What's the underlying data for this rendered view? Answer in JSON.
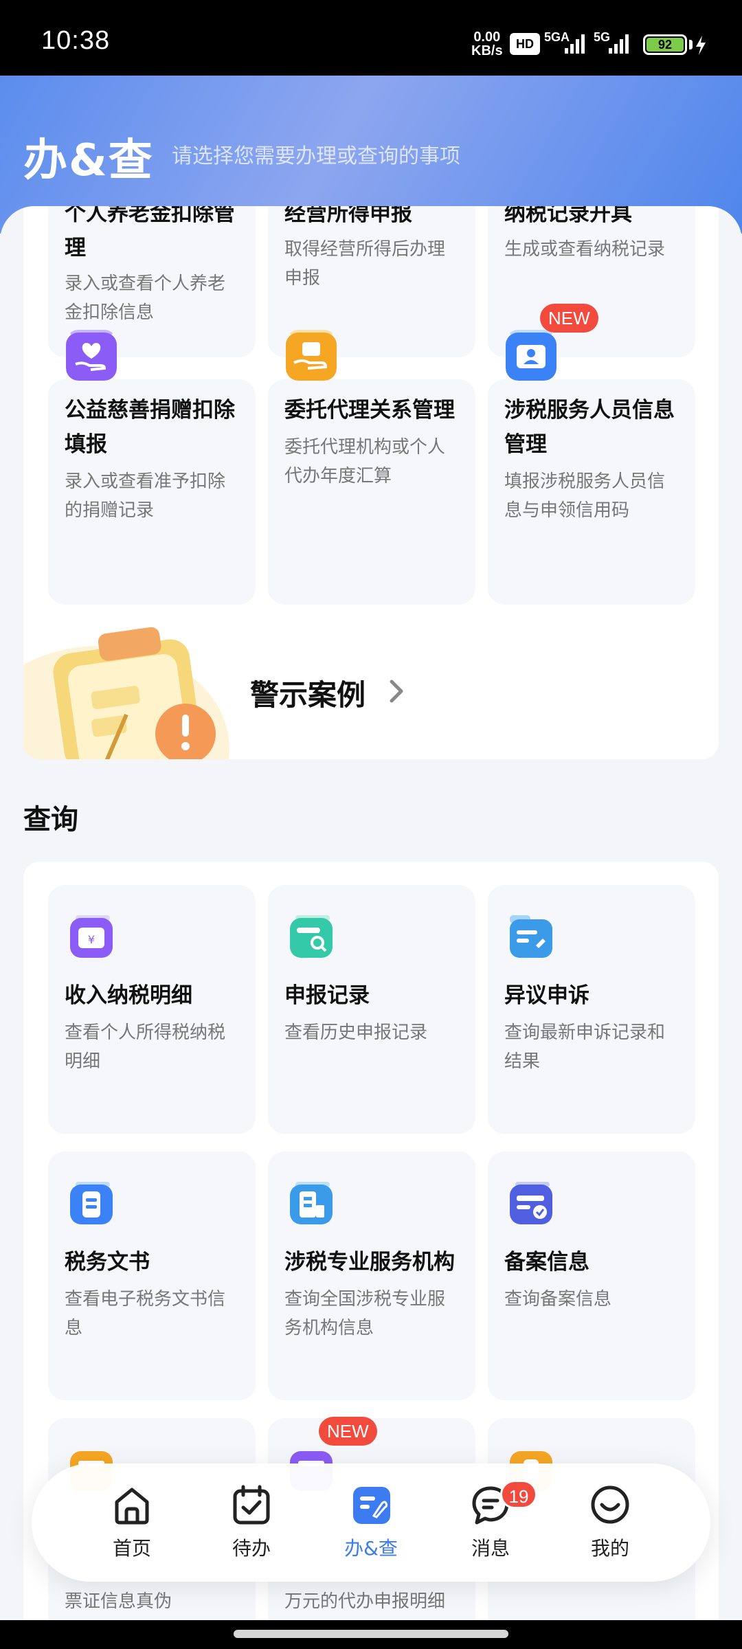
{
  "status_bar": {
    "time": "10:38",
    "net_speed_value": "0.00",
    "net_speed_unit": "KB/s",
    "hd_label": "HD",
    "sim1_label": "5GA",
    "sim2_label": "5G",
    "battery": "92"
  },
  "header": {
    "title": "办&查",
    "subtitle": "请选择您需要办理或查询的事项"
  },
  "handle_section": {
    "tiles": [
      {
        "title": "个人养老金扣除管理",
        "desc": "录入或查看个人养老金扣除信息"
      },
      {
        "title": "经营所得申报",
        "desc": "取得经营所得后办理申报"
      },
      {
        "title": "纳税记录开具",
        "desc": "生成或查看纳税记录"
      },
      {
        "title": "公益慈善捐赠扣除填报",
        "desc": "录入或查看准予扣除的捐赠记录",
        "icon": "charity-donation-icon",
        "color": "#8b5cf6"
      },
      {
        "title": "委托代理关系管理",
        "desc": "委托代理机构或个人代办年度汇算",
        "icon": "proxy-hand-icon",
        "color": "#f5a623"
      },
      {
        "title": "涉税服务人员信息管理",
        "desc": "填报涉税服务人员信息与申领信用码",
        "icon": "person-folder-icon",
        "color": "#3b82f6",
        "badge": "NEW"
      }
    ],
    "warning": {
      "label": "警示案例"
    }
  },
  "query_section": {
    "title": "查询",
    "tiles": [
      {
        "title": "收入纳税明细",
        "desc": "查看个人所得税纳税明细",
        "icon": "income-wallet-icon",
        "color": "#8b5cf6"
      },
      {
        "title": "申报记录",
        "desc": "查看历史申报记录",
        "icon": "record-search-icon",
        "color": "#34c9a9"
      },
      {
        "title": "异议申诉",
        "desc": "查询最新申诉记录和结果",
        "icon": "appeal-folder-icon",
        "color": "#3b9be8"
      },
      {
        "title": "税务文书",
        "desc": "查看电子税务文书信息",
        "icon": "tax-document-icon",
        "color": "#3b82f6"
      },
      {
        "title": "涉税专业服务机构",
        "desc": "查询全国涉税专业服务机构信息",
        "icon": "service-building-icon",
        "color": "#3b9be8"
      },
      {
        "title": "备案信息",
        "desc": "查询备案信息",
        "icon": "filing-card-icon",
        "color": "#4f5fe0"
      },
      {
        "title": "",
        "desc": "票证信息真伪",
        "icon": "ticket-icon",
        "color": "#f5a623"
      },
      {
        "title": "",
        "desc": "万元的代办申报明细",
        "icon": "proxy-detail-icon",
        "color": "#8b5cf6",
        "badge": "NEW"
      },
      {
        "title": "",
        "desc": "",
        "icon": "misc-icon",
        "color": "#f5a623"
      }
    ]
  },
  "bottom_nav": {
    "items": [
      {
        "label": "首页",
        "icon": "home-icon"
      },
      {
        "label": "待办",
        "icon": "calendar-check-icon"
      },
      {
        "label": "办&查",
        "icon": "handle-query-icon",
        "active": true
      },
      {
        "label": "消息",
        "icon": "message-icon",
        "badge": "19"
      },
      {
        "label": "我的",
        "icon": "smile-icon"
      }
    ]
  }
}
